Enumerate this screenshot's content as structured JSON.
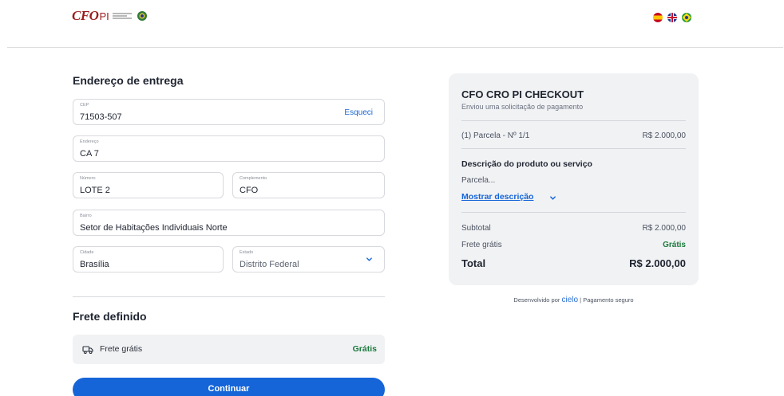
{
  "header": {
    "logo": {
      "mark": "CFO",
      "suffix": "PI"
    },
    "languages": [
      {
        "code": "es",
        "icon": "spain-flag-icon"
      },
      {
        "code": "en",
        "icon": "uk-flag-icon"
      },
      {
        "code": "pt",
        "icon": "brazil-flag-icon"
      }
    ]
  },
  "address": {
    "title": "Endereço de entrega",
    "cep": {
      "label": "CEP",
      "value": "71503-507",
      "link": "Esqueci"
    },
    "endereco": {
      "label": "Endereço",
      "value": "CA 7"
    },
    "numero": {
      "label": "Número",
      "value": "LOTE 2"
    },
    "complemento": {
      "label": "Complemento",
      "value": "CFO"
    },
    "bairro": {
      "label": "Bairro",
      "value": "Setor de Habitações Individuais Norte"
    },
    "cidade": {
      "label": "Cidade",
      "value": "Brasília"
    },
    "estado": {
      "label": "Estado",
      "value": "Distrito Federal"
    }
  },
  "shipping": {
    "title": "Frete definido",
    "option_label": "Frete grátis",
    "option_price": "Grátis",
    "icon": "truck-icon"
  },
  "continue_label": "Continuar",
  "summary": {
    "title": "CFO CRO PI CHECKOUT",
    "subtitle": "Enviou uma solicitação de pagamento",
    "installment_label": "(1) Parcela - Nº 1/1",
    "installment_value": "R$ 2.000,00",
    "desc_title": "Descrição do produto ou serviço",
    "desc_text": "Parcela...",
    "show_more": "Mostrar descrição",
    "subtotal_label": "Subtotal",
    "subtotal_value": "R$ 2.000,00",
    "shipping_label": "Frete grátis",
    "shipping_value": "Grátis",
    "total_label": "Total",
    "total_value": "R$ 2.000,00"
  },
  "footer": {
    "developed_by": "Desenvolvido por",
    "brand": "cielo",
    "separator": "|",
    "secure": "Pagamento seguro"
  },
  "colors": {
    "primary": "#1565d8",
    "success": "#1a7a3c",
    "brand_red": "#9b1c1c",
    "panel_bg": "#f1f2f4"
  }
}
